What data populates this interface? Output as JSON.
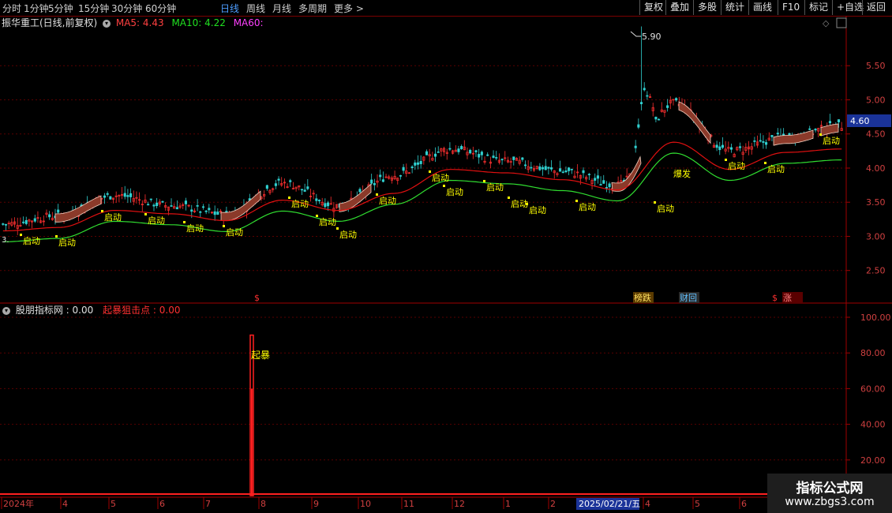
{
  "toolbar": {
    "timeframes": [
      {
        "label": "分时",
        "active": false
      },
      {
        "label": "1分钟",
        "active": false
      },
      {
        "label": "5分钟",
        "active": false
      },
      {
        "label": "15分钟",
        "active": false
      },
      {
        "label": "30分钟",
        "active": false
      },
      {
        "label": "60分钟",
        "active": false
      },
      {
        "label": "日线",
        "active": true
      },
      {
        "label": "周线",
        "active": false
      },
      {
        "label": "月线",
        "active": false
      },
      {
        "label": "多周期",
        "active": false
      },
      {
        "label": "更多",
        "active": false
      }
    ],
    "more_arrow": ">",
    "right_buttons": [
      "复权",
      "叠加",
      "多股",
      "统计",
      "画线",
      "F10",
      "标记",
      "+自选",
      "返回"
    ]
  },
  "main_chart": {
    "stock_title": "振华重工(日线,前复权)",
    "ma5_label": "MA5: 4.43",
    "ma10_label": "MA10: 4.22",
    "ma60_label": "MA60:",
    "price_axis": [
      "5.50",
      "5.00",
      "4.50",
      "4.00",
      "3.50",
      "3.00",
      "2.50"
    ],
    "current_price": "4.60",
    "high_label": "5.90",
    "low_label": "3.",
    "qidong_label": "启动",
    "baofa_label": "爆发",
    "event_tags": [
      {
        "text": "$"
      },
      {
        "text": "榜跌"
      },
      {
        "text": "财回"
      },
      {
        "text": "$"
      },
      {
        "text": "涨"
      }
    ]
  },
  "sub_chart": {
    "indicator_name": "股朋指标网",
    "indicator_value": ": 0.00",
    "signal_name": "起暴狙击点",
    "signal_value": ": 0.00",
    "axis": [
      "100.00",
      "80.00",
      "60.00",
      "40.00",
      "20.00"
    ],
    "spike_label": "起暴"
  },
  "time_axis": {
    "labels": [
      "2024年",
      "4",
      "5",
      "6",
      "7",
      "8",
      "9",
      "10",
      "11",
      "12",
      "1",
      "2",
      "4",
      "5",
      "6"
    ],
    "cursor_date": "2025/02/21/五"
  },
  "watermark": {
    "line1": "指标公式网",
    "line2": "www.zbgs3.com"
  },
  "colors": {
    "ma5": "#ff4040",
    "ma10": "#20e020",
    "ma60": "#ff40ff",
    "up_candle": "#ff3030",
    "down_candle": "#30d0d0",
    "red_ma": "#e01010",
    "green_ma": "#30dd30",
    "signal": "#ffff00"
  },
  "chart_data": {
    "type": "line",
    "title": "振华重工(日线,前复权)",
    "x": [
      "2024年",
      "4",
      "5",
      "6",
      "7",
      "8",
      "9",
      "10",
      "11",
      "12",
      "1",
      "2",
      "4",
      "5",
      "6"
    ],
    "series": [
      {
        "name": "MA5",
        "values": [
          3.18,
          3.3,
          3.6,
          3.45,
          3.32,
          3.78,
          3.45,
          3.9,
          4.28,
          4.1,
          3.95,
          3.75,
          4.95,
          4.25,
          4.45,
          4.62
        ]
      },
      {
        "name": "MA10",
        "values": [
          3.2,
          3.25,
          3.5,
          3.45,
          3.35,
          3.65,
          3.5,
          3.75,
          4.1,
          4.05,
          3.95,
          3.8,
          4.5,
          4.1,
          4.35,
          4.4
        ]
      }
    ],
    "ylim": [
      2.3,
      6.0
    ],
    "sub_indicator": {
      "name": "起暴狙击点",
      "spike_index": 5,
      "spike_value": 90,
      "ylim": [
        0,
        100
      ]
    }
  }
}
